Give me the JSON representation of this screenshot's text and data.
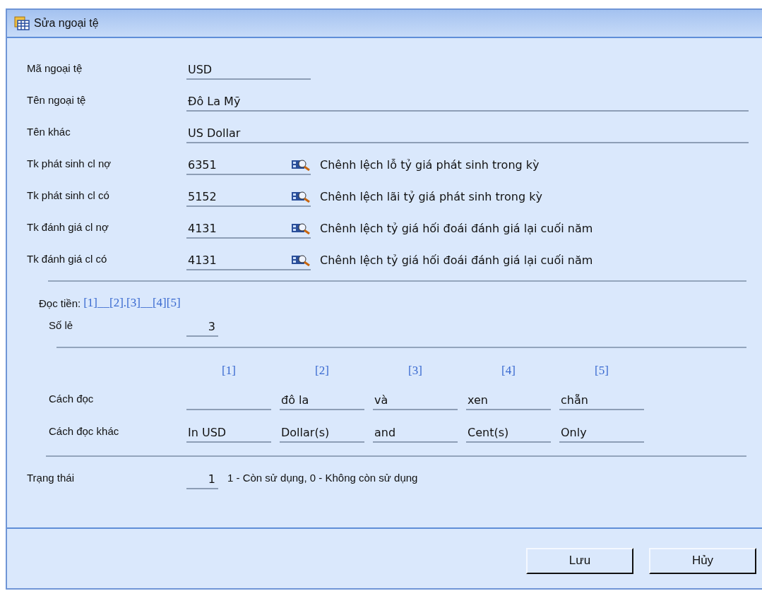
{
  "window": {
    "title": "Sửa ngoại tệ"
  },
  "fields": [
    {
      "kind": "short",
      "label": "Mã ngoại tệ",
      "value": "USD"
    },
    {
      "kind": "wide",
      "label": "Tên ngoại tệ",
      "value": "Đô La Mỹ"
    },
    {
      "kind": "wide",
      "label": "Tên khác",
      "value": "US Dollar"
    },
    {
      "kind": "account",
      "label": "Tk phát sinh cl nợ",
      "value": "6351",
      "description": "Chênh lệch lỗ tỷ giá phát sinh trong kỳ"
    },
    {
      "kind": "account",
      "label": "Tk phát sinh cl có",
      "value": "5152",
      "description": "Chênh lệch lãi tỷ giá phát sinh trong kỳ"
    },
    {
      "kind": "account",
      "label": "Tk đánh giá cl nợ",
      "value": "4131",
      "description": "Chênh lệch tỷ giá hối đoái đánh giá lại cuối năm"
    },
    {
      "kind": "account",
      "label": "Tk đánh giá cl có",
      "value": "4131",
      "description": "Chênh lệch tỷ giá hối đoái đánh giá lại cuối năm"
    }
  ],
  "reading_format": {
    "label": "Đọc tiền:",
    "pattern": "[1]__[2].[3]__[4][5]"
  },
  "decimals": {
    "label": "Số lẻ",
    "value": "3"
  },
  "reading_table": {
    "headers": [
      "[1]",
      "[2]",
      "[3]",
      "[4]",
      "[5]"
    ],
    "rows": [
      {
        "label": "Cách đọc",
        "cells": [
          {
            "kind": "blank"
          },
          {
            "kind": "text",
            "value": "đô la"
          },
          {
            "kind": "text",
            "value": "và"
          },
          {
            "kind": "text",
            "value": "xen"
          },
          {
            "kind": "text",
            "value": "chẵn"
          }
        ]
      },
      {
        "label": "Cách đọc khác",
        "cells": [
          {
            "kind": "text",
            "value": "In USD"
          },
          {
            "kind": "text",
            "value": "Dollar(s)"
          },
          {
            "kind": "text",
            "value": "and"
          },
          {
            "kind": "text",
            "value": "Cent(s)"
          },
          {
            "kind": "text",
            "value": "Only"
          }
        ]
      }
    ]
  },
  "status": {
    "label": "Trạng thái",
    "value": "1",
    "description": "1 - Còn sử dụng, 0 - Không còn sử dụng"
  },
  "buttons": [
    "Lưu",
    "Hủy"
  ]
}
